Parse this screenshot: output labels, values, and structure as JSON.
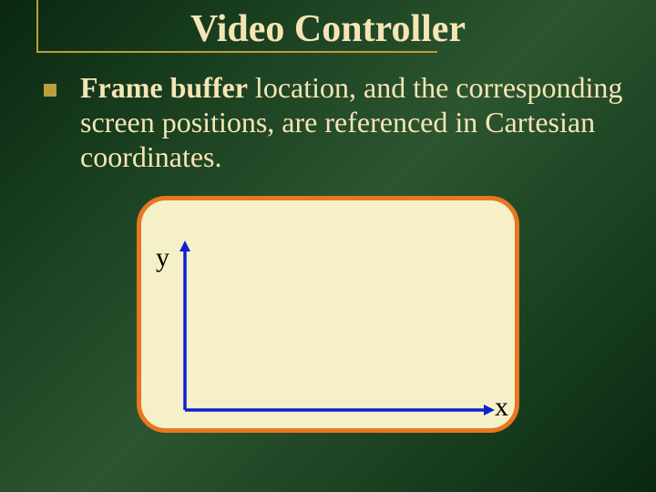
{
  "slide": {
    "title": "Video Controller",
    "bullet_text_bold": "Frame buffer",
    "bullet_text_rest": " location, and the corresponding screen positions, are referenced in Cartesian coordinates."
  },
  "diagram": {
    "y_axis_label": "y",
    "x_axis_label": "x"
  }
}
